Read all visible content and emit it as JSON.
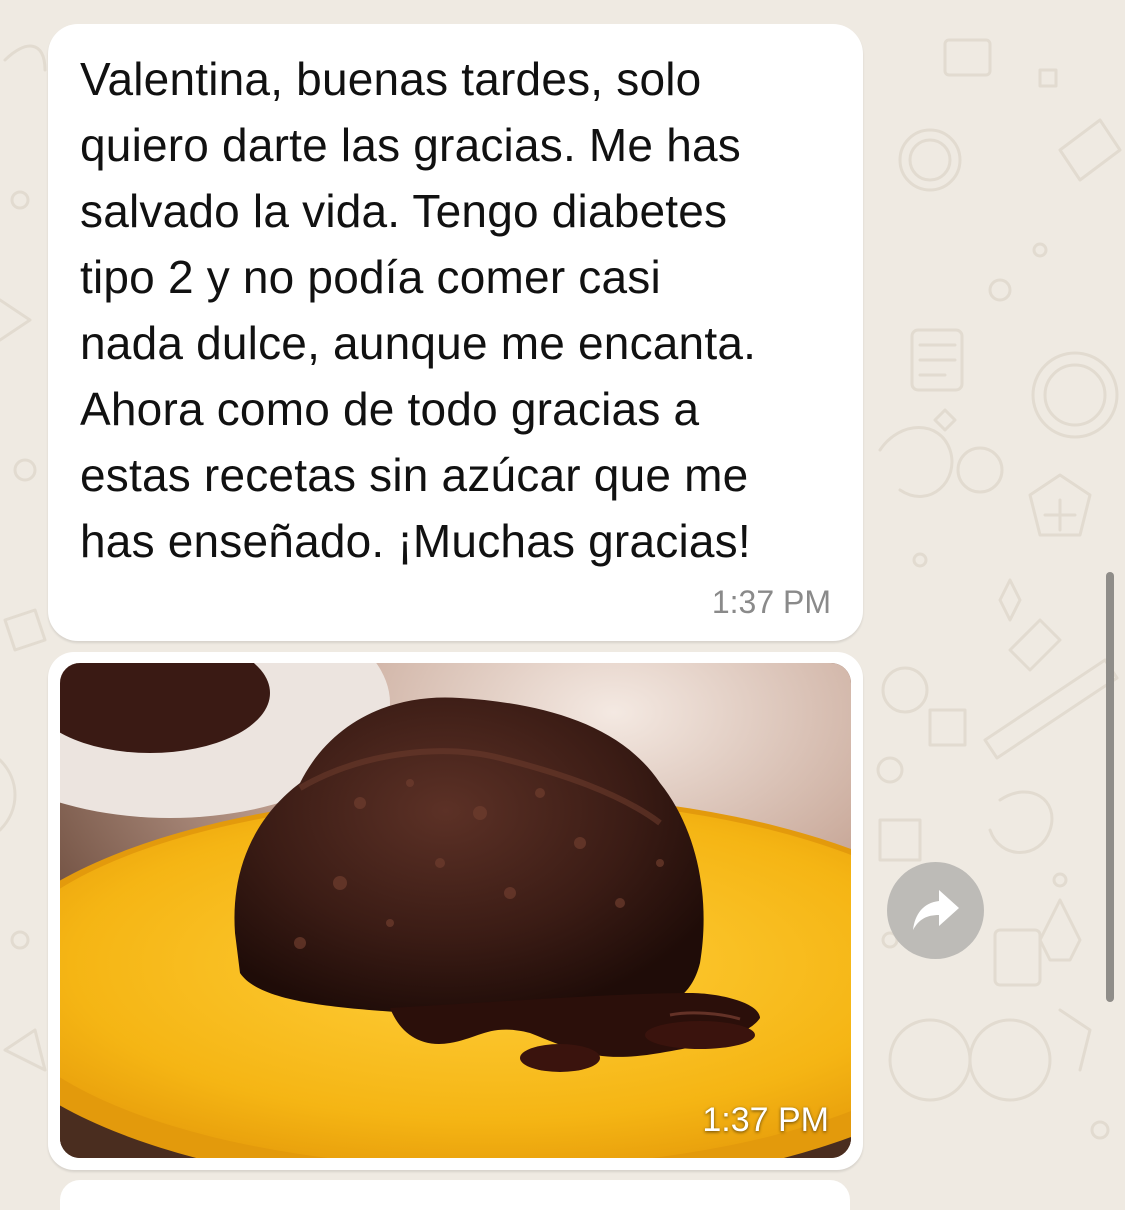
{
  "messages": [
    {
      "type": "text",
      "text": "Valentina, buenas tardes, solo\nquiero darte las gracias. Me has\nsalvado la vida. Tengo diabetes\ntipo 2 y no podía comer casi\nnada dulce, aunque me encanta.\nAhora como de todo gracias a\nestas recetas sin azúcar que me\nhas enseñado. ¡Muchas gracias!",
      "time": "1:37 PM"
    },
    {
      "type": "image",
      "image_description": "chocolate-cake-slice-on-yellow-plate",
      "time": "1:37 PM"
    }
  ],
  "icons": {
    "forward": "forward-arrow-icon"
  },
  "colors": {
    "chat_background": "#efeae2",
    "bubble": "#ffffff",
    "forward_button": "#bdbbb7"
  }
}
